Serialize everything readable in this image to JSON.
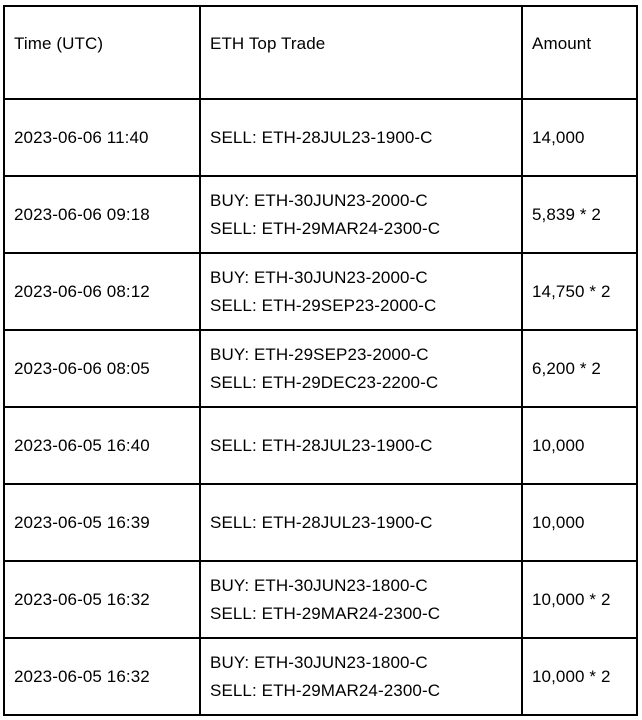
{
  "table": {
    "columns": [
      {
        "key": "time",
        "label": "Time (UTC)"
      },
      {
        "key": "trade",
        "label": "ETH Top Trade"
      },
      {
        "key": "amount",
        "label": "Amount"
      }
    ],
    "rows": [
      {
        "time": "2023-06-06 11:40",
        "trade_lines": [
          "SELL: ETH-28JUL23-1900-C"
        ],
        "amount": "14,000"
      },
      {
        "time": "2023-06-06 09:18",
        "trade_lines": [
          "BUY: ETH-30JUN23-2000-C",
          "SELL: ETH-29MAR24-2300-C"
        ],
        "amount": "5,839 * 2"
      },
      {
        "time": "2023-06-06 08:12",
        "trade_lines": [
          "BUY: ETH-30JUN23-2000-C",
          "SELL: ETH-29SEP23-2000-C"
        ],
        "amount": "14,750 * 2"
      },
      {
        "time": "2023-06-06 08:05",
        "trade_lines": [
          "BUY: ETH-29SEP23-2000-C",
          "SELL: ETH-29DEC23-2200-C"
        ],
        "amount": "6,200 * 2"
      },
      {
        "time": "2023-06-05 16:40",
        "trade_lines": [
          "SELL: ETH-28JUL23-1900-C"
        ],
        "amount": "10,000"
      },
      {
        "time": "2023-06-05 16:39",
        "trade_lines": [
          "SELL: ETH-28JUL23-1900-C"
        ],
        "amount": "10,000"
      },
      {
        "time": "2023-06-05 16:32",
        "trade_lines": [
          "BUY: ETH-30JUN23-1800-C",
          "SELL: ETH-29MAR24-2300-C"
        ],
        "amount": "10,000 * 2"
      },
      {
        "time": "2023-06-05 16:32",
        "trade_lines": [
          "BUY: ETH-30JUN23-1800-C",
          "SELL: ETH-29MAR24-2300-C"
        ],
        "amount": "10,000 * 2"
      }
    ],
    "colors": {
      "border": "#000000",
      "background": "#ffffff",
      "text": "#000000"
    }
  }
}
